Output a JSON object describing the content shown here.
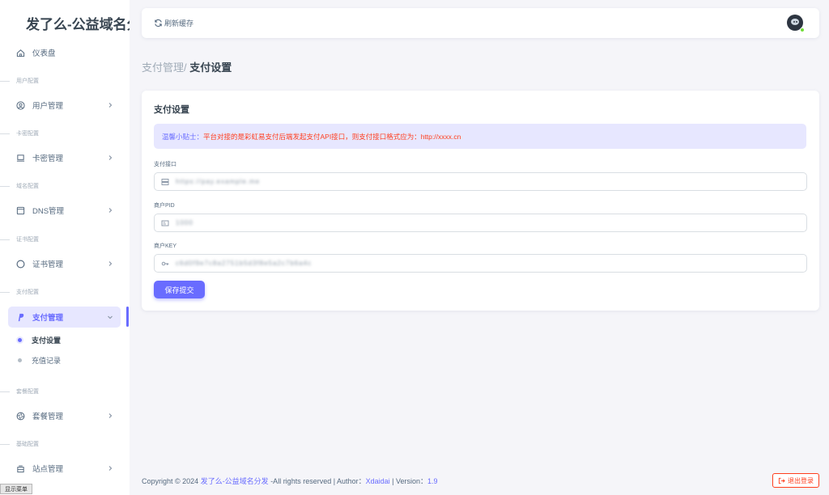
{
  "brand": {
    "name": "发了么-公益域名分发"
  },
  "sidebar": {
    "dashboard": "仪表盘",
    "sections": [
      {
        "header": "用户配置",
        "item": "用户管理"
      },
      {
        "header": "卡密配置",
        "item": "卡密管理"
      },
      {
        "header": "域名配置",
        "item": "DNS管理"
      },
      {
        "header": "证书配置",
        "item": "证书管理"
      },
      {
        "header": "支付配置",
        "item": "支付管理"
      },
      {
        "header": "套餐配置",
        "item": "套餐管理"
      },
      {
        "header": "基础配置",
        "item": "站点管理"
      }
    ],
    "payment_sub": [
      "支付设置",
      "充值记录"
    ],
    "show_menu": "显示菜单"
  },
  "topbar": {
    "refresh_label": "刷新缓存"
  },
  "breadcrumb": {
    "parent": "支付管理/",
    "current": "支付设置"
  },
  "card": {
    "title": "支付设置",
    "alert_label": "温馨小贴士：",
    "alert_message": "平台对接的是彩虹易支付后端发起支付API接口，则支付接口格式应为：http://xxxx.cn",
    "fields": [
      {
        "label": "支付接口",
        "value": "https://pay.example.me"
      },
      {
        "label": "商户PID",
        "value": "1000"
      },
      {
        "label": "商户KEY",
        "value": "c6d0f9e7c8a2751b5d3f8e5a2c7b6a4c"
      }
    ],
    "submit": "保存提交"
  },
  "footer": {
    "copyright": "Copyright © 2024 ",
    "site": "发了么-公益域名分发",
    "rights": " -All rights reserved | Author：",
    "author": "Xdaidai",
    "version_label": " | Version：",
    "version": "1.9"
  },
  "logout": "退出登录",
  "colors": {
    "accent": "#696cff",
    "danger": "#ff3e1d",
    "success": "#71dd37"
  }
}
